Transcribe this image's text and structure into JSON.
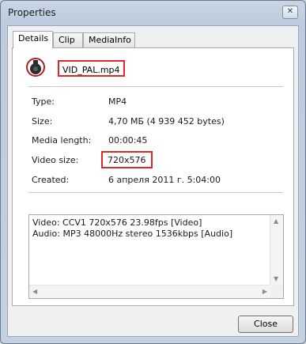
{
  "window": {
    "title": "Properties",
    "close_glyph": "✕"
  },
  "tabs": [
    {
      "label": "Details",
      "active": true
    },
    {
      "label": "Clip",
      "active": false
    },
    {
      "label": "MediaInfo",
      "active": false
    }
  ],
  "file": {
    "name": "VID_PAL.mp4",
    "icon": "media-file-icon"
  },
  "details": [
    {
      "label": "Type:",
      "value": "MP4"
    },
    {
      "label": "Size:",
      "value": "4,70 МБ (4 939 452 bytes)"
    },
    {
      "label": "Media length:",
      "value": "00:00:45"
    },
    {
      "label": "Video size:",
      "value": "720x576"
    },
    {
      "label": "Created:",
      "value": "6 апреля 2011 г. 5:04:00"
    }
  ],
  "mediainfo_lines": [
    "Video: CCV1 720x576 23.98fps [Video]",
    "Audio: MP3 48000Hz stereo 1536kbps [Audio]"
  ],
  "buttons": {
    "close_label": "Close"
  },
  "colors": {
    "highlight": "#e2262b"
  }
}
